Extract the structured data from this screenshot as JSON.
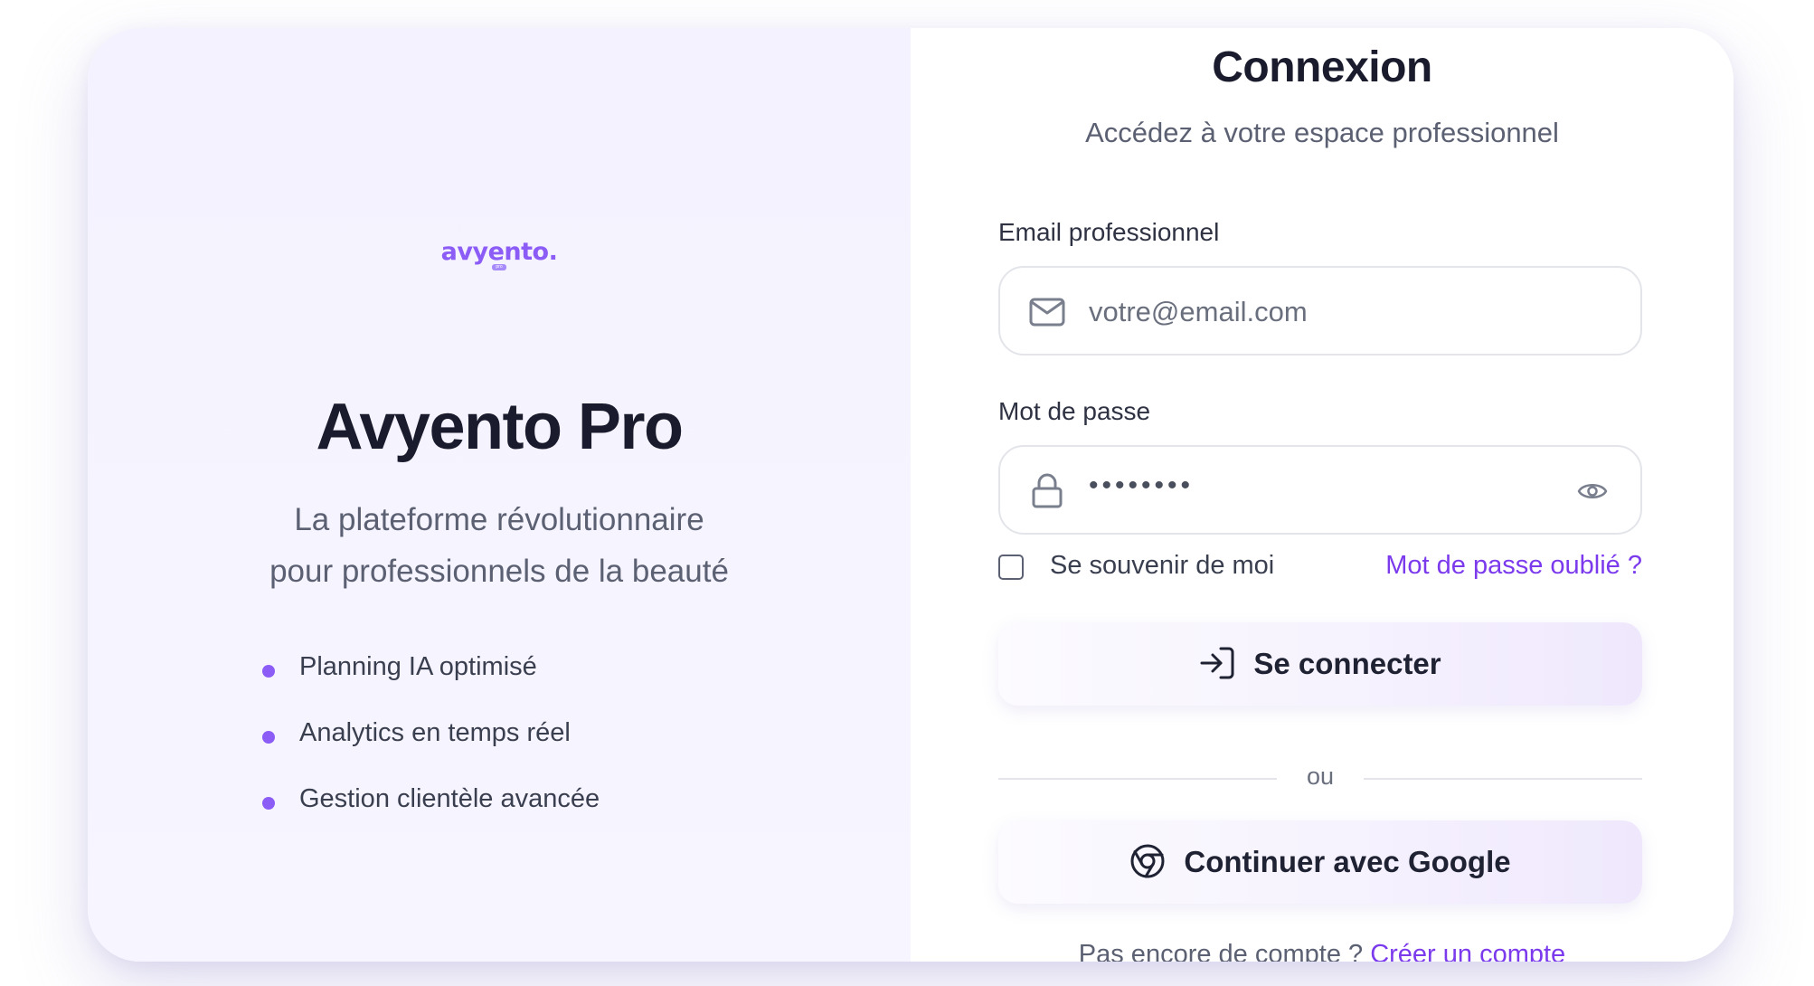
{
  "brand": {
    "logo_text": "avyento.",
    "logo_badge": "pro",
    "title": "Avyento Pro",
    "tagline_line1": "La plateforme révolutionnaire",
    "tagline_line2": "pour professionnels de la beauté",
    "features": [
      "Planning IA optimisé",
      "Analytics en temps réel",
      "Gestion clientèle avancée"
    ],
    "accent_color": "#8b5cf6"
  },
  "login": {
    "title": "Connexion",
    "subtitle": "Accédez à votre espace professionnel",
    "email_label": "Email professionnel",
    "email_placeholder": "votre@email.com",
    "password_label": "Mot de passe",
    "password_masked": "••••••••",
    "remember_label": "Se souvenir de moi",
    "forgot_link": "Mot de passe oublié ?",
    "submit_label": "Se connecter",
    "divider_text": "ou",
    "google_label": "Continuer avec Google",
    "signup_prompt": "Pas encore de compte ?",
    "signup_link": "Créer un compte",
    "link_color": "#7c3aed"
  },
  "icons": {
    "email": "mail-icon",
    "password": "lock-icon",
    "toggle": "eye-icon",
    "submit": "log-in-icon",
    "google": "chrome-icon"
  }
}
